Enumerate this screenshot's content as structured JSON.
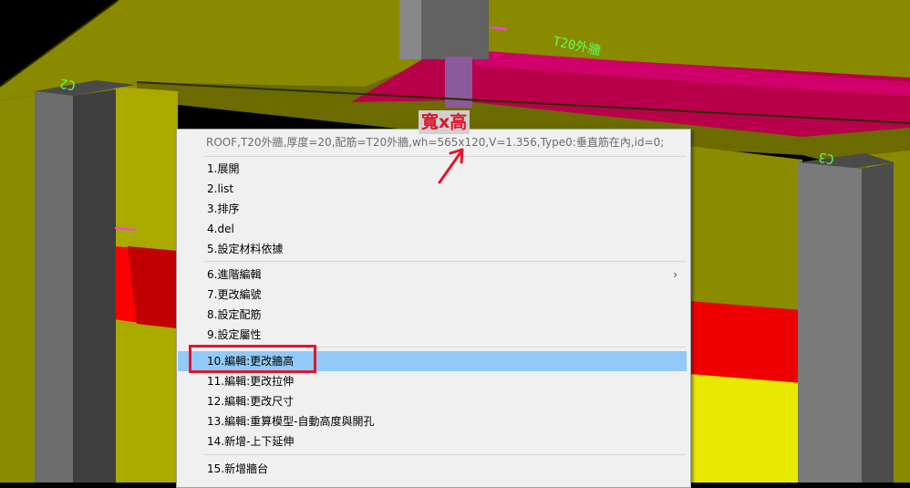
{
  "menu": {
    "header": "ROOF,T20外牆,厚度=20,配筋=T20外牆,wh=565x120,V=1.356,Type0:垂直筋在內,id=0;",
    "items": [
      {
        "label": "1.展開"
      },
      {
        "label": "2.list"
      },
      {
        "label": "3.排序"
      },
      {
        "label": "4.del"
      },
      {
        "label": "5.設定材料依據"
      },
      {
        "label": "6.進階編輯",
        "has_submenu": true
      },
      {
        "label": "7.更改編號"
      },
      {
        "label": "8.設定配筋"
      },
      {
        "label": "9.設定屬性"
      },
      {
        "label": "10.編輯:更改牆高",
        "highlighted": true
      },
      {
        "label": "11.編輯:更改拉伸"
      },
      {
        "label": "12.編輯:更改尺寸"
      },
      {
        "label": "13.編輯:重算模型-自動高度與開孔"
      },
      {
        "label": "14.新增-上下延伸"
      },
      {
        "label": "15.新增牆台"
      }
    ]
  },
  "annotation": {
    "text": "寬x高",
    "color": "#e0152b"
  },
  "model_labels": {
    "wall_tag": "T20外牆",
    "column_left": "C2",
    "column_right": "C3"
  },
  "colors": {
    "highlight": "#91c9f7",
    "wall_yellow": "#8e8e00",
    "beam_red": "#e00000",
    "column_gray": "#5a5a5a"
  }
}
